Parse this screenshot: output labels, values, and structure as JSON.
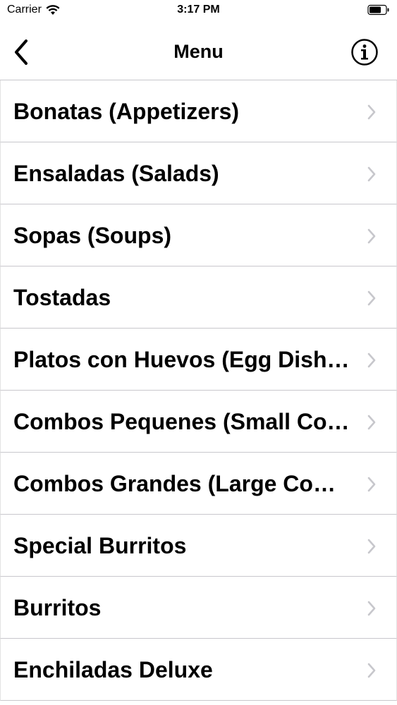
{
  "status_bar": {
    "carrier": "Carrier",
    "time": "3:17 PM"
  },
  "nav": {
    "title": "Menu",
    "back_icon": "chevron-left-icon",
    "info_icon": "info-icon"
  },
  "menu_items": [
    {
      "label": "Bonatas (Appetizers)"
    },
    {
      "label": "Ensaladas (Salads)"
    },
    {
      "label": "Sopas (Soups)"
    },
    {
      "label": "Tostadas"
    },
    {
      "label": "Platos con Huevos (Egg Dishes)"
    },
    {
      "label": "Combos Pequenes (Small Combos)"
    },
    {
      "label": "Combos Grandes (Large Combos)"
    },
    {
      "label": "Special Burritos"
    },
    {
      "label": "Burritos"
    },
    {
      "label": "Enchiladas Deluxe"
    }
  ],
  "colors": {
    "separator": "#c8c7cc",
    "chevron": "#c7c7cc",
    "text": "#000000",
    "background": "#ffffff"
  }
}
